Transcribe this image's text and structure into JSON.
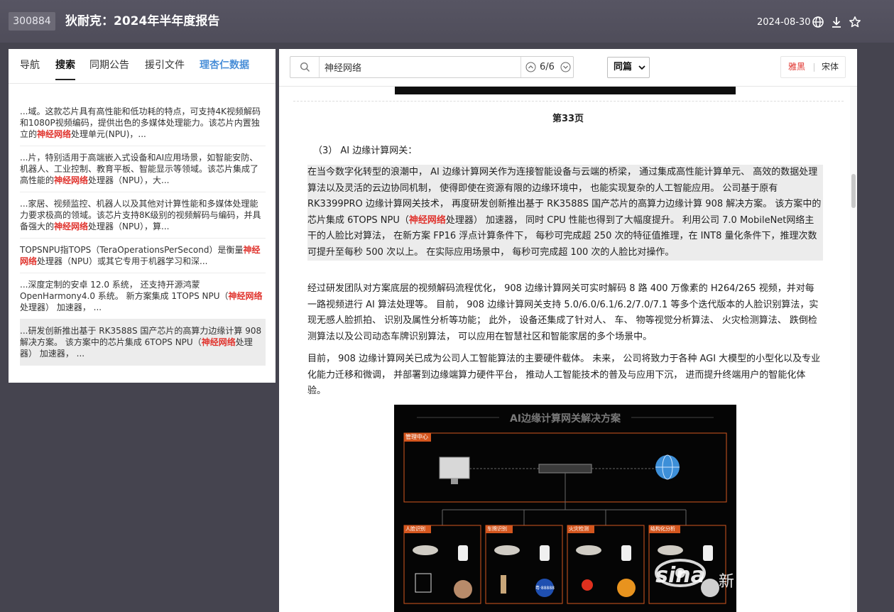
{
  "header": {
    "stock_code": "300884",
    "title": "狄耐克：2024年半年度报告",
    "date": "2024-08-30"
  },
  "left_panel": {
    "tabs": [
      {
        "label": "导航"
      },
      {
        "label": "搜索"
      },
      {
        "label": "同期公告"
      },
      {
        "label": "援引文件"
      },
      {
        "label": "理杏仁数据"
      }
    ],
    "results": [
      {
        "before": "...域。这款芯片具有高性能和低功耗的特点，可支持4K视频解码和1080P视频编码，提供出色的多媒体处理能力。该芯片内置独立的",
        "hit": "神经网络",
        "after": "处理单元(NPU)，..."
      },
      {
        "before": "...片，特别适用于高端嵌入式设备和AI应用场景，如智能安防、机器人、工业控制、教育平板、智能显示等领域。该芯片集成了高性能的",
        "hit": "神经网络",
        "after": "处理器（NPU），大..."
      },
      {
        "before": "...家居、视频监控、机器人以及其他对计算性能和多媒体处理能力要求极高的领域。该芯片支持8K级别的视频解码与编码，并具备强大的",
        "hit": "神经网络",
        "after": "处理器（NPU），算..."
      },
      {
        "before": "TOPSNPU指TOPS（TeraOperationsPerSecond）是衡量",
        "hit": "神经网络",
        "after": "处理器（NPU）或其它专用于机器学习和深..."
      },
      {
        "before": "...深度定制的安卓 12.0 系统， 还支持开源鸿蒙 OpenHarmony4.0 系统。 新方案集成 1TOPS NPU（",
        "hit": "神经网络",
        "after": "处理器） 加速器， ..."
      },
      {
        "before": "...研发创新推出基于 RK3588S 国产芯片的高算力边缘计算 908 解决方案。 该方案中的芯片集成 6TOPS NPU（",
        "hit": "神经网络",
        "after": "处理器） 加速器， ..."
      }
    ]
  },
  "toolbar": {
    "search_value": "神经网络",
    "match_count": "6/6",
    "scope": "同篇",
    "font_options": [
      "雅黑",
      "宋体"
    ]
  },
  "document": {
    "page_label": "第33页",
    "section_heading": "（3） AI 边缘计算网关：",
    "highlight_para": {
      "before": "在当今数字化转型的浪潮中， AI 边缘计算网关作为连接智能设备与云端的桥梁， 通过集成高性能计算单元、 高效的数据处理算法以及灵活的云边协同机制， 使得即使在资源有限的边缘环境中， 也能实现复杂的人工智能应用。 公司基于原有 RK3399PRO 边缘计算网关技术， 再度研发创新推出基于 RK3588S 国产芯片的高算力边缘计算 908 解决方案。 该方案中的芯片集成 6TOPS NPU（",
      "hit": "神经网络",
      "after": "处理器） 加速器， 同时 CPU 性能也得到了大幅度提升。 利用公司 7.0 MobileNet网络主干的人脸比对算法， 在新方案 FP16 浮点计算条件下， 每秒可完成超 250 次的特征值推理，在 INT8 量化条件下，推理次数可提升至每秒 500 次以上。 在实际应用场景中， 每秒可完成超 100 次的人脸比对操作。"
    },
    "para2": "经过研发团队对方案底层的视频解码流程优化， 908 边缘计算网关可实时解码 8 路 400 万像素的 H264/265 视频，并对每一路视频进行 AI 算法处理等。 目前， 908 边缘计算网关支持 5.0/6.0/6.1/6.2/7.0/7.1 等多个迭代版本的人脸识别算法，实现无感人脸抓拍、 识别及属性分析等功能； 此外， 设备还集成了针对人、 车、 物等视觉分析算法、 火灾检测算法、 跌倒检测算法以及公司动态车牌识别算法， 可以应用在智慧社区和智能家居的多个场景中。",
    "para3": "目前， 908 边缘计算网关已成为公司人工智能算法的主要硬件载体。 未来， 公司将致力于各种 AGI 大模型的小型化以及专业化能力迁移和微调， 并部署到边缘端算力硬件平台， 推动人工智能技术的普及与应用下沉， 进而提升终端用户的智能化体验。",
    "figure": {
      "title": "AI边缘计算网关解决方案",
      "management_label": "管理中心",
      "sub_labels": [
        "人脸识别",
        "车牌识别",
        "火灾检测",
        "结构化分析"
      ],
      "plate_text": "粤·88888"
    }
  },
  "watermark": {
    "brand": "sina",
    "text": "新浪财经社区"
  },
  "colors": {
    "topbar": "#54525f",
    "background": "#45444f",
    "highlight_red": "#e0332d",
    "tab_blue": "#4a8fd8",
    "figure_accent": "#d4561e"
  }
}
